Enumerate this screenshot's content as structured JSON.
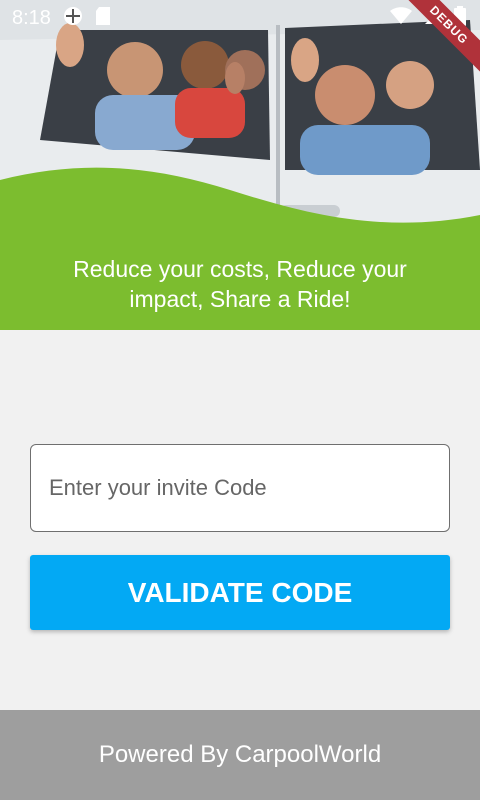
{
  "status_bar": {
    "time": "8:18",
    "icons": [
      "data-saver-icon",
      "sd-card-icon",
      "wifi-icon",
      "signal-icon",
      "battery-icon"
    ]
  },
  "debug_banner": "DEBUG",
  "hero": {
    "tagline": "Reduce your costs, Reduce your impact, Share a Ride!",
    "accent_color": "#7cbd2f"
  },
  "form": {
    "invite_placeholder": "Enter your invite Code",
    "invite_value": "",
    "validate_label": "VALIDATE CODE",
    "button_color": "#03a9f4"
  },
  "footer": {
    "text": "Powered By CarpoolWorld",
    "color": "#9e9e9e"
  }
}
